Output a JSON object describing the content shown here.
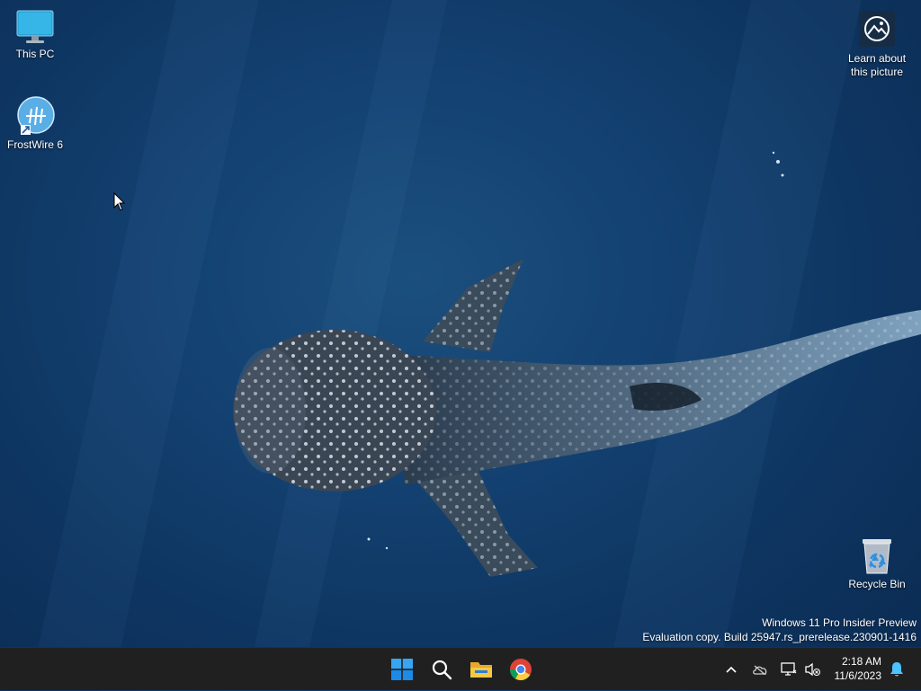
{
  "desktop": {
    "icons": [
      {
        "label": "This PC",
        "icon": "monitor-icon"
      },
      {
        "label": "FrostWire 6",
        "icon": "frostwire-icon"
      },
      {
        "label": "Recycle Bin",
        "icon": "recycle-bin-icon"
      },
      {
        "label": "Learn about\nthis picture",
        "icon": "camera-icon"
      }
    ],
    "learn_line1": "Learn about",
    "learn_line2": "this picture"
  },
  "watermark": {
    "line1": "Windows 11 Pro Insider Preview",
    "line2": "Evaluation copy. Build 25947.rs_prerelease.230901-1416"
  },
  "taskbar": {
    "apps": [
      "start-icon",
      "search-icon",
      "file-explorer-icon",
      "chrome-icon"
    ],
    "tray": [
      "chevron-up-icon",
      "onedrive-icon",
      "network-icon",
      "volume-muted-icon",
      "notification-bell-icon"
    ],
    "time": "2:18 AM",
    "date": "11/6/2023"
  },
  "colors": {
    "taskbar": "#202020",
    "win_blue": "#0078d4",
    "bell_blue": "#4cc2ff",
    "ocean": "#134171"
  }
}
